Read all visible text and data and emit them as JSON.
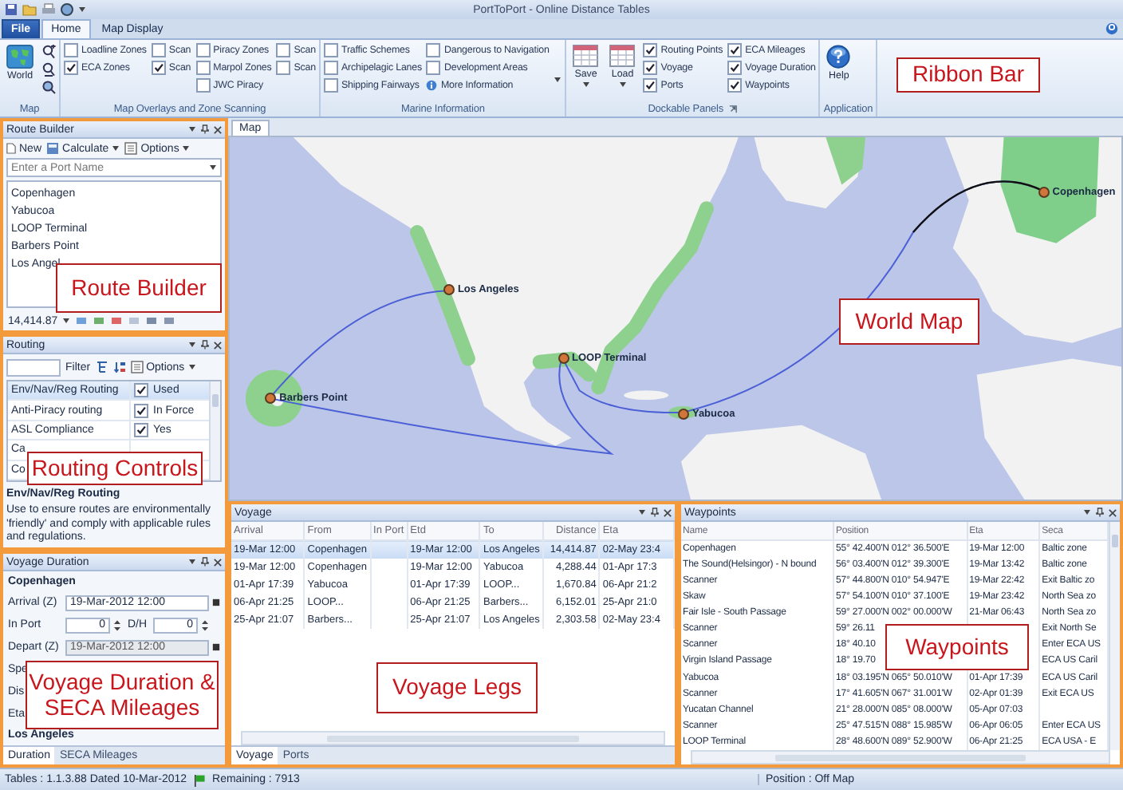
{
  "window": {
    "title": "PortToPort - Online Distance Tables"
  },
  "ribbon_tabs": [
    {
      "label": "File",
      "kind": "file",
      "selected": false
    },
    {
      "label": "Home",
      "kind": "tab",
      "selected": true
    },
    {
      "label": "Map Display",
      "kind": "tab",
      "selected": false
    }
  ],
  "ribbon": {
    "callout": "Ribbon Bar",
    "groups": [
      {
        "label": "Map",
        "kind": "map",
        "big": [
          {
            "label": "World",
            "kind": "world"
          }
        ]
      },
      {
        "label": "Map Overlays and Zone Scanning",
        "kind": "plain",
        "columns": [
          [
            {
              "label": "Loadline Zones",
              "kind": "check",
              "checked": false
            },
            {
              "label": "ECA Zones",
              "kind": "check",
              "checked": true
            }
          ],
          [
            {
              "label": "Scan",
              "kind": "check",
              "checked": false
            },
            {
              "label": "Scan",
              "kind": "check",
              "checked": true
            }
          ],
          [
            {
              "label": "Piracy Zones",
              "kind": "check",
              "checked": false
            },
            {
              "label": "Marpol Zones",
              "kind": "check",
              "checked": false
            },
            {
              "label": "JWC Piracy",
              "kind": "check",
              "checked": false
            }
          ],
          [
            {
              "label": "Scan",
              "kind": "check",
              "checked": false
            },
            {
              "label": "Scan",
              "kind": "check",
              "checked": false
            }
          ]
        ]
      },
      {
        "label": "Marine Information",
        "kind": "menu",
        "columns": [
          [
            {
              "label": "Traffic Schemes",
              "kind": "check",
              "checked": false
            },
            {
              "label": "Archipelagic Lanes",
              "kind": "check",
              "checked": false
            },
            {
              "label": "Shipping Fairways",
              "kind": "check",
              "checked": false
            }
          ],
          [
            {
              "label": "Dangerous to Navigation",
              "kind": "check",
              "checked": false
            },
            {
              "label": "Development Areas",
              "kind": "check",
              "checked": false
            },
            {
              "label": "More Information",
              "kind": "info"
            }
          ]
        ]
      },
      {
        "label": "Dockable Panels",
        "kind": "launcher",
        "big": [
          {
            "label": "Save",
            "kind": "save"
          },
          {
            "label": "Load",
            "kind": "load"
          }
        ],
        "columns": [
          [
            {
              "label": "Routing Points",
              "kind": "check",
              "checked": true
            },
            {
              "label": "Voyage",
              "kind": "check",
              "checked": true
            },
            {
              "label": "Ports",
              "kind": "check",
              "checked": true
            }
          ],
          [
            {
              "label": "ECA Mileages",
              "kind": "check",
              "checked": true
            },
            {
              "label": "Voyage Duration",
              "kind": "check",
              "checked": true
            },
            {
              "label": "Waypoints",
              "kind": "check",
              "checked": true
            }
          ]
        ]
      },
      {
        "label": "Application",
        "kind": "plain",
        "big": [
          {
            "label": "Help",
            "kind": "help"
          }
        ]
      }
    ]
  },
  "route_builder": {
    "title": "Route Builder",
    "toolbar": [
      "New",
      "Calculate",
      "Options"
    ],
    "placeholder": "Enter a Port Name",
    "ports": [
      "Copenhagen",
      "Yabucoa",
      "LOOP Terminal",
      "Barbers Point",
      "Los Angel"
    ],
    "total": "14,414.87",
    "callout": "Route Builder"
  },
  "routing": {
    "title": "Routing",
    "filter": "Filter",
    "options": "Options",
    "rows": [
      {
        "name": "Env/Nav/Reg Routing",
        "value": "Used",
        "checked": true,
        "selected": true
      },
      {
        "name": "Anti-Piracy routing",
        "value": "In Force",
        "checked": true,
        "selected": false
      },
      {
        "name": "ASL Compliance",
        "value": "Yes",
        "checked": true,
        "selected": false
      },
      {
        "name": "Ca"
      },
      {
        "name": "Co"
      }
    ],
    "description_title": "Env/Nav/Reg Routing",
    "description": "Use to ensure routes are environmentally 'friendly' and comply with applicable rules and regulations.",
    "callout": "Routing Controls"
  },
  "voyage_duration": {
    "title": "Voyage Duration",
    "start_port": "Copenhagen",
    "fields": [
      {
        "kind": "date",
        "label": "Arrival (Z)",
        "value": "19-Mar-2012 12:00",
        "disabled": false
      },
      {
        "kind": "spin",
        "label": "In Port",
        "value": "0",
        "label2": "D/H",
        "value2": "0"
      },
      {
        "kind": "date",
        "label": "Depart (Z)",
        "value": "19-Mar-2012 12:00",
        "disabled": true
      },
      {
        "kind": "label",
        "label": "Spe"
      },
      {
        "kind": "label",
        "label": "Dis"
      },
      {
        "kind": "label",
        "label": "Eta"
      }
    ],
    "end_port": "Los Angeles",
    "tabs": [
      {
        "label": "Duration",
        "selected": true
      },
      {
        "label": "SECA Mileages",
        "selected": false
      }
    ],
    "callout": "Voyage Duration & SECA Mileages"
  },
  "map": {
    "tab": "Map",
    "ports": [
      {
        "label": "Copenhagen"
      },
      {
        "label": "Los Angeles"
      },
      {
        "label": "LOOP Terminal"
      },
      {
        "label": "Barbers Point"
      },
      {
        "label": "Yabucoa"
      }
    ],
    "callout": "World Map"
  },
  "voyage": {
    "title": "Voyage",
    "columns": [
      "Arrival",
      "From",
      "In Port",
      "Etd",
      "To",
      "Distance",
      "Eta"
    ],
    "rows": [
      {
        "cells": [
          "19-Mar 12:00",
          "Copenhagen",
          "",
          "19-Mar 12:00",
          "Los Angeles",
          "14,414.87",
          "02-May 23:4"
        ],
        "selected": true
      },
      {
        "cells": [
          "19-Mar 12:00",
          "Copenhagen",
          "",
          "19-Mar 12:00",
          "Yabucoa",
          "4,288.44",
          "01-Apr 17:3"
        ],
        "selected": false
      },
      {
        "cells": [
          "01-Apr 17:39",
          "Yabucoa",
          "",
          "01-Apr 17:39",
          "LOOP...",
          "1,670.84",
          "06-Apr 21:2"
        ],
        "selected": false
      },
      {
        "cells": [
          "06-Apr 21:25",
          "LOOP...",
          "",
          "06-Apr 21:25",
          "Barbers...",
          "6,152.01",
          "25-Apr 21:0"
        ],
        "selected": false
      },
      {
        "cells": [
          "25-Apr 21:07",
          "Barbers...",
          "",
          "25-Apr 21:07",
          "Los Angeles",
          "2,303.58",
          "02-May 23:4"
        ],
        "selected": false
      }
    ],
    "tabs": [
      {
        "label": "Voyage",
        "selected": true
      },
      {
        "label": "Ports",
        "selected": false
      }
    ],
    "callout": "Voyage Legs"
  },
  "waypoints": {
    "title": "Waypoints",
    "columns": [
      "Name",
      "Position",
      "Eta",
      "Seca"
    ],
    "rows": [
      {
        "name": "Copenhagen",
        "position": "55° 42.400'N 012° 36.500'E",
        "eta": "19-Mar 12:00",
        "seca": "Baltic zone"
      },
      {
        "name": "The Sound(Helsingor) - N bound",
        "position": "56° 03.400'N 012° 39.300'E",
        "eta": "19-Mar 13:42",
        "seca": "Baltic zone"
      },
      {
        "name": "Scanner",
        "position": "57° 44.800'N 010° 54.947'E",
        "eta": "19-Mar 22:42",
        "seca": "Exit Baltic zo"
      },
      {
        "name": "Skaw",
        "position": "57° 54.100'N 010° 37.100'E",
        "eta": "19-Mar 23:42",
        "seca": "North Sea zo"
      },
      {
        "name": "Fair Isle - South Passage",
        "position": "59° 27.000'N 002° 00.000'W",
        "eta": "21-Mar 06:43",
        "seca": "North Sea zo"
      },
      {
        "name": "Scanner",
        "position": "59° 26.11",
        "seca": "Exit North Se"
      },
      {
        "name": "Scanner",
        "position": "18° 40.10",
        "seca": "Enter ECA US"
      },
      {
        "name": "Virgin Island Passage",
        "position": "18° 19.70",
        "seca": "ECA US Caril"
      },
      {
        "name": "Yabucoa",
        "position": "18° 03.195'N 065° 50.010'W",
        "eta": "01-Apr 17:39",
        "seca": "ECA US Caril"
      },
      {
        "name": "Scanner",
        "position": "17° 41.605'N 067° 31.001'W",
        "eta": "02-Apr 01:39",
        "seca": "Exit ECA US"
      },
      {
        "name": "Yucatan Channel",
        "position": "21° 28.000'N 085° 08.000'W",
        "eta": "05-Apr 07:03"
      },
      {
        "name": "Scanner",
        "position": "25° 47.515'N 088° 15.985'W",
        "eta": "06-Apr 06:05",
        "seca": "Enter ECA US"
      },
      {
        "name": "LOOP Terminal",
        "position": "28° 48.600'N 089° 52.900'W",
        "eta": "06-Apr 21:25",
        "seca": "ECA USA - E"
      }
    ],
    "callout": "Waypoints"
  },
  "status_bar": {
    "tables": "Tables :  1.1.3.88 Dated 10-Mar-2012",
    "remaining": "Remaining :  7913",
    "position": "Position :  Off Map"
  }
}
